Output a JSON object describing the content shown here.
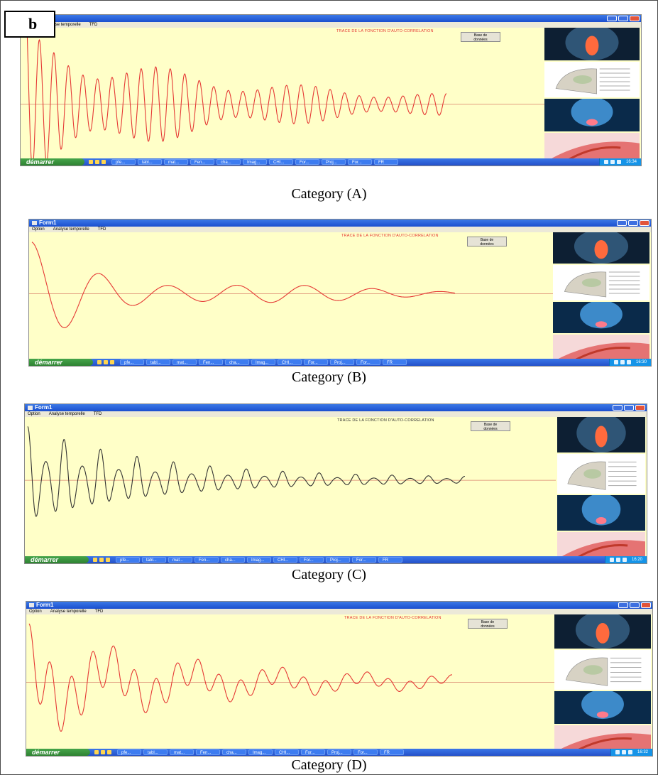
{
  "figure": {
    "panel_letter": "b"
  },
  "window": {
    "title": "Form1",
    "menu": [
      "Option",
      "Analyse temporelle",
      "TFD"
    ]
  },
  "plot": {
    "title": "TRACE DE LA FONCTION D'AUTO-CORRELATION",
    "db_button_line1": "Base de",
    "db_button_line2": "données"
  },
  "taskbar": {
    "start_label": "démarrer",
    "tasks": [
      "pfe...",
      "tabl...",
      "mat...",
      "Fen...",
      "cha...",
      "Imag...",
      "CHI...",
      "For...",
      "Proj...",
      "For...",
      "FR"
    ],
    "clocks": [
      "16:34",
      "16:30",
      "16:20",
      "16:32"
    ]
  },
  "captions": [
    "Category (A)",
    "Category (B)",
    "Category (C)",
    "Category (D)"
  ],
  "colors": {
    "plot_bg": "#ffffc8",
    "trace_red": "#e53935",
    "trace_black": "#333333",
    "baseline": "#d9826b",
    "titlebar": "#2a5fd6",
    "start_green": "#3a9a3e"
  },
  "icons": {
    "side_images": [
      "throat-anatomy-image",
      "vocal-tract-diagram-image",
      "head-xray-image",
      "neck-section-image"
    ]
  }
}
